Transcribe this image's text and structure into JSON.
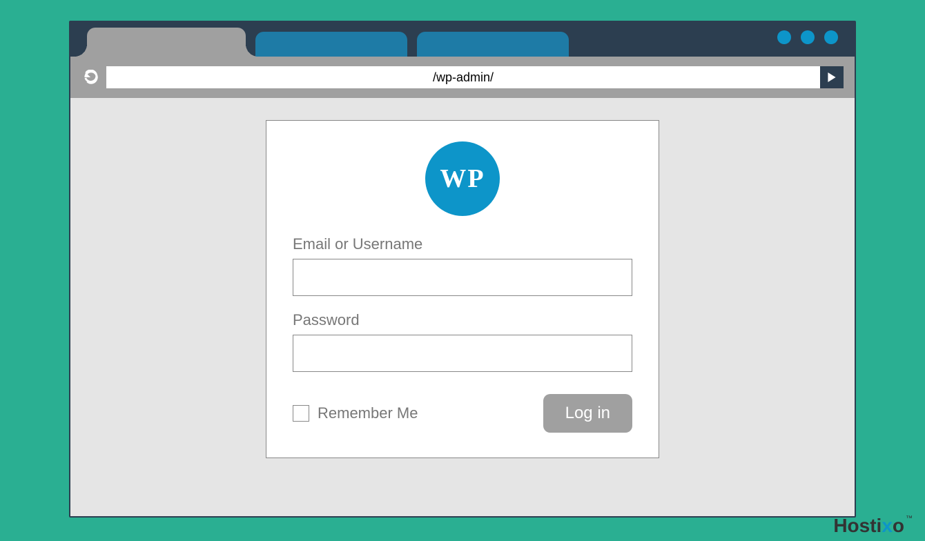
{
  "browser": {
    "url": "/wp-admin/"
  },
  "login": {
    "logo_text": "WP",
    "email_label": "Email or Username",
    "email_value": "",
    "password_label": "Password",
    "password_value": "",
    "remember_label": "Remember Me",
    "submit_label": "Log in"
  },
  "brand": {
    "name_part1": "Hosti",
    "name_accent": "x",
    "name_part2": "o",
    "tm": "™"
  }
}
